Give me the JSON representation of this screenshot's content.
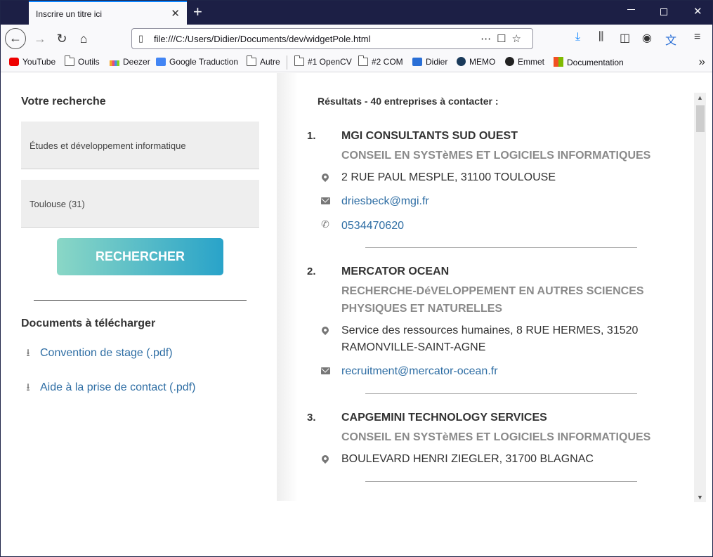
{
  "browser": {
    "tab_title": "Inscrire un titre ici",
    "tab_close": "✕",
    "new_tab": "+",
    "url": "file:///C:/Users/Didier/Documents/dev/widgetPole.html",
    "bookmarks": [
      {
        "label": "YouTube",
        "icon": "youtube-icon"
      },
      {
        "label": "Outils",
        "icon": "folder-icon"
      },
      {
        "label": "Deezer",
        "icon": "deezer-icon"
      },
      {
        "label": "Google Traduction",
        "icon": "google-translate-icon"
      },
      {
        "label": "Autre",
        "icon": "folder-icon"
      },
      {
        "label": "#1 OpenCV",
        "icon": "folder-icon"
      },
      {
        "label": "#2 COM",
        "icon": "folder-icon"
      },
      {
        "label": "Didier",
        "icon": "d-logo-icon"
      },
      {
        "label": "MEMO",
        "icon": "memo-icon"
      },
      {
        "label": "Emmet",
        "icon": "emmet-icon"
      },
      {
        "label": "Documentation",
        "icon": "microsoft-icon"
      }
    ]
  },
  "search": {
    "heading": "Votre recherche",
    "activity_value": "Études et développement informatique",
    "location_value": "Toulouse (31)",
    "button_label": "RECHERCHER"
  },
  "documents": {
    "heading": "Documents à télécharger",
    "links": [
      "Convention de stage (.pdf)",
      "Aide à la prise de contact (.pdf)"
    ]
  },
  "results": {
    "title": "Résultats - 40 entreprises à contacter :",
    "entries": [
      {
        "num": "1.",
        "name": "MGI CONSULTANTS SUD OUEST",
        "activity": "CONSEIL EN SYSTèMES ET LOGICIELS INFORMATIQUES",
        "address": "2 RUE PAUL MESPLE, 31100 TOULOUSE",
        "email": "driesbeck@mgi.fr",
        "phone": "0534470620"
      },
      {
        "num": "2.",
        "name": "MERCATOR OCEAN",
        "activity": "RECHERCHE-DéVELOPPEMENT EN AUTRES SCIENCES PHYSIQUES ET NATURELLES",
        "address": "Service des ressources humaines, 8 RUE HERMES, 31520 RAMONVILLE-SAINT-AGNE",
        "email": "recruitment@mercator-ocean.fr"
      },
      {
        "num": "3.",
        "name": "CAPGEMINI TECHNOLOGY SERVICES",
        "activity": "CONSEIL EN SYSTèMES ET LOGICIELS INFORMATIQUES",
        "address": "BOULEVARD HENRI ZIEGLER, 31700 BLAGNAC"
      }
    ]
  },
  "colors": {
    "tabbar": "#1c1f45",
    "link": "#2f6ea4",
    "button_gradient_start": "#8ad7c6",
    "button_gradient_end": "#29a3c9"
  }
}
